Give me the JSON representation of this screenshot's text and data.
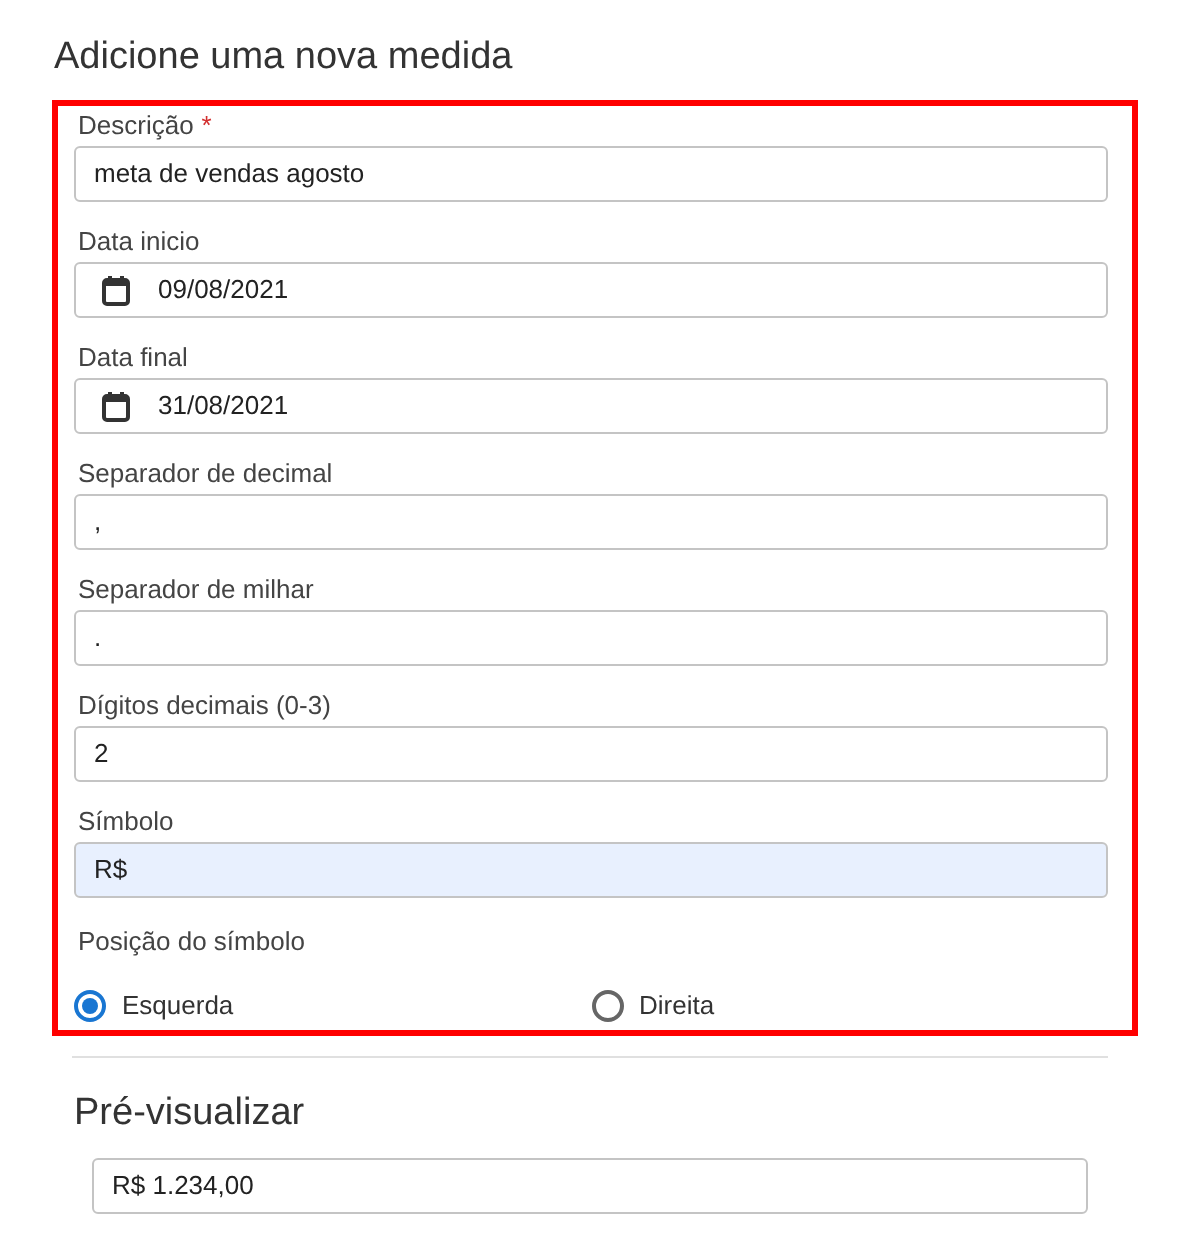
{
  "title": "Adicione uma nova medida",
  "fields": [
    {
      "kind": "text",
      "label": "Descrição",
      "required_mark": "*",
      "value": "meta de vendas agosto",
      "autofilled": false
    },
    {
      "kind": "date",
      "label": "Data inicio",
      "value": "09/08/2021",
      "autofilled": false
    },
    {
      "kind": "date",
      "label": "Data final",
      "value": "31/08/2021",
      "autofilled": false
    },
    {
      "kind": "text",
      "label": "Separador de decimal",
      "value": ",",
      "autofilled": false
    },
    {
      "kind": "text",
      "label": "Separador de milhar",
      "value": ".",
      "autofilled": false
    },
    {
      "kind": "text",
      "label": "Dígitos decimais (0-3)",
      "value": "2",
      "autofilled": false
    },
    {
      "kind": "text",
      "label": "Símbolo",
      "value": "R$",
      "autofilled": true
    }
  ],
  "symbol_position": {
    "label": "Posição do símbolo",
    "options": [
      {
        "label": "Esquerda",
        "selected": true
      },
      {
        "label": "Direita",
        "selected": false
      }
    ]
  },
  "preview": {
    "title": "Pré-visualizar",
    "value": "R$ 1.234,00"
  }
}
